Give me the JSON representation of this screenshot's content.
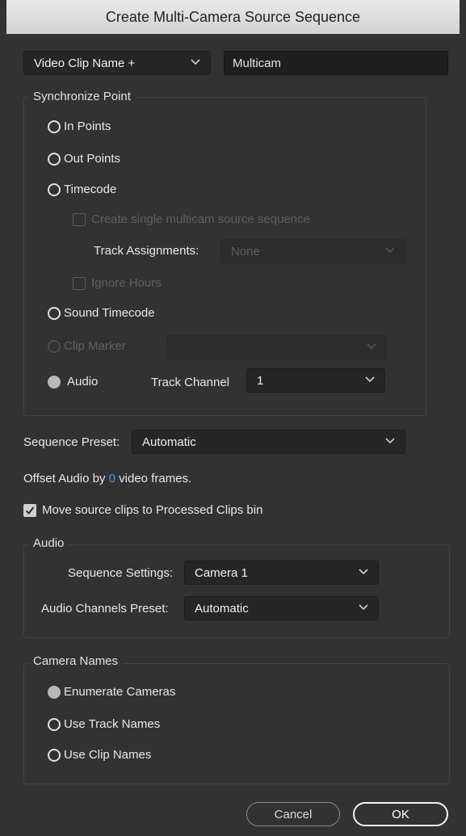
{
  "window": {
    "title": "Create Multi-Camera Source Sequence"
  },
  "naming": {
    "mode": "Video Clip Name +",
    "name_value": "Multicam"
  },
  "sync": {
    "legend": "Synchronize Point",
    "in_points": "In Points",
    "out_points": "Out Points",
    "timecode": "Timecode",
    "create_single": "Create single multicam source sequence",
    "track_assignments_label": "Track Assignments:",
    "track_assignments_value": "None",
    "ignore_hours": "Ignore Hours",
    "sound_timecode": "Sound Timecode",
    "clip_marker": "Clip Marker",
    "audio": "Audio",
    "track_channel_label": "Track Channel",
    "track_channel_value": "1"
  },
  "sequence_preset": {
    "label": "Sequence Preset:",
    "value": "Automatic"
  },
  "offset": {
    "prefix": "Offset Audio by",
    "value": "0",
    "suffix": "video frames."
  },
  "move_clips": {
    "label": "Move source clips to Processed Clips bin",
    "checked": true
  },
  "audio_group": {
    "legend": "Audio",
    "sequence_settings_label": "Sequence Settings:",
    "sequence_settings_value": "Camera 1",
    "channels_preset_label": "Audio Channels Preset:",
    "channels_preset_value": "Automatic"
  },
  "camera_names": {
    "legend": "Camera Names",
    "enumerate": "Enumerate Cameras",
    "track_names": "Use Track Names",
    "clip_names": "Use Clip Names"
  },
  "buttons": {
    "cancel": "Cancel",
    "ok": "OK"
  }
}
